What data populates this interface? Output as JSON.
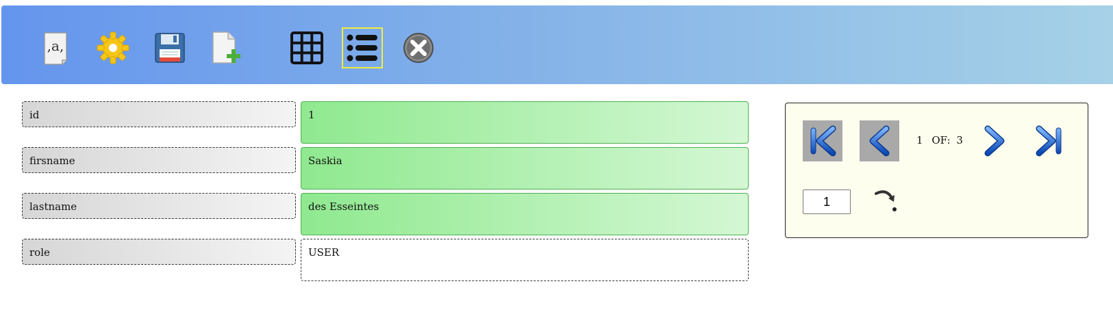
{
  "toolbar": {
    "buttons": [
      {
        "icon": "text-quote-icon"
      },
      {
        "icon": "gear-icon"
      },
      {
        "icon": "save-floppy-icon"
      },
      {
        "icon": "new-document-icon"
      },
      {
        "icon": "grid-view-icon"
      },
      {
        "icon": "list-view-icon",
        "selected": true
      },
      {
        "icon": "close-icon"
      }
    ],
    "selected_highlight": "#f4ee3c"
  },
  "form": {
    "fields": [
      {
        "label": "id",
        "value": "1"
      },
      {
        "label": "firsname",
        "value": "Saskia"
      },
      {
        "label": "lastname",
        "value": "des Esseintes"
      },
      {
        "label": "role",
        "value": "USER"
      }
    ]
  },
  "pager": {
    "current": "1",
    "of_label": "OF:",
    "total": "3",
    "goto_value": "1",
    "buttons": [
      {
        "icon": "first-page-icon",
        "disabled": true
      },
      {
        "icon": "previous-page-icon",
        "disabled": true
      },
      {
        "icon": "next-page-icon",
        "disabled": false
      },
      {
        "icon": "last-page-icon",
        "disabled": false
      },
      {
        "icon": "go-arrow-icon"
      }
    ]
  },
  "colors": {
    "toolbar_gradient_start": "#6495ed",
    "toolbar_gradient_end": "#a6d1e7",
    "field_green": "#8fe98f",
    "pager_background": "#fefeef",
    "disabled_button": "#a9a9a9"
  }
}
